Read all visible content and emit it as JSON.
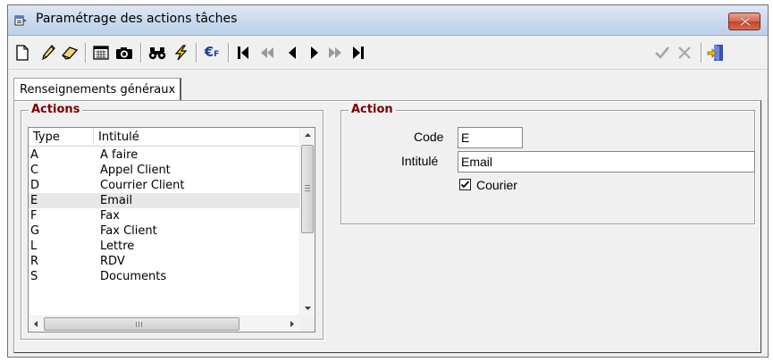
{
  "window": {
    "title": "Paramétrage des actions tâches",
    "close_icon": "close-icon"
  },
  "toolbar": {
    "buttons": [
      {
        "name": "new-icon"
      },
      {
        "name": "edit-pencil-icon"
      },
      {
        "name": "eraser-icon"
      },
      {
        "name": "calendar-icon"
      },
      {
        "name": "camera-icon"
      },
      {
        "name": "binoculars-icon"
      },
      {
        "name": "lightning-icon"
      },
      {
        "name": "euro-icon",
        "label": "€",
        "sub_label": "F"
      },
      {
        "name": "first-record-icon"
      },
      {
        "name": "rewind-icon"
      },
      {
        "name": "previous-record-icon"
      },
      {
        "name": "next-record-icon"
      },
      {
        "name": "fast-forward-icon"
      },
      {
        "name": "last-record-icon"
      },
      {
        "name": "validate-check-icon"
      },
      {
        "name": "cancel-x-icon"
      },
      {
        "name": "exit-door-icon"
      }
    ]
  },
  "tabs": [
    {
      "label": "Renseignements généraux",
      "active": true
    }
  ],
  "actions_group": {
    "legend": "Actions",
    "columns": [
      "Type",
      "Intitulé"
    ],
    "rows": [
      {
        "type": "A",
        "intitule": "A faire"
      },
      {
        "type": "C",
        "intitule": "Appel Client"
      },
      {
        "type": "D",
        "intitule": "Courrier Client"
      },
      {
        "type": "E",
        "intitule": "Email",
        "selected": true
      },
      {
        "type": "F",
        "intitule": "Fax"
      },
      {
        "type": "G",
        "intitule": "Fax Client"
      },
      {
        "type": "L",
        "intitule": "Lettre"
      },
      {
        "type": "R",
        "intitule": "RDV"
      },
      {
        "type": "S",
        "intitule": "Documents"
      }
    ],
    "hscroll_grip": "III"
  },
  "action_group": {
    "legend": "Action",
    "code_label": "Code",
    "code_value": "E",
    "intitule_label": "Intitulé",
    "intitule_value": "Email",
    "courier_label": "Courier",
    "courier_checked": true
  },
  "colors": {
    "legend": "#7a0000",
    "title_gradient_top": "#dfe9f5",
    "title_gradient_bottom": "#bcd0ea",
    "close_button": "#c0452a",
    "selected_row": "#e8e8e8",
    "euro": "#1a3f9a"
  }
}
